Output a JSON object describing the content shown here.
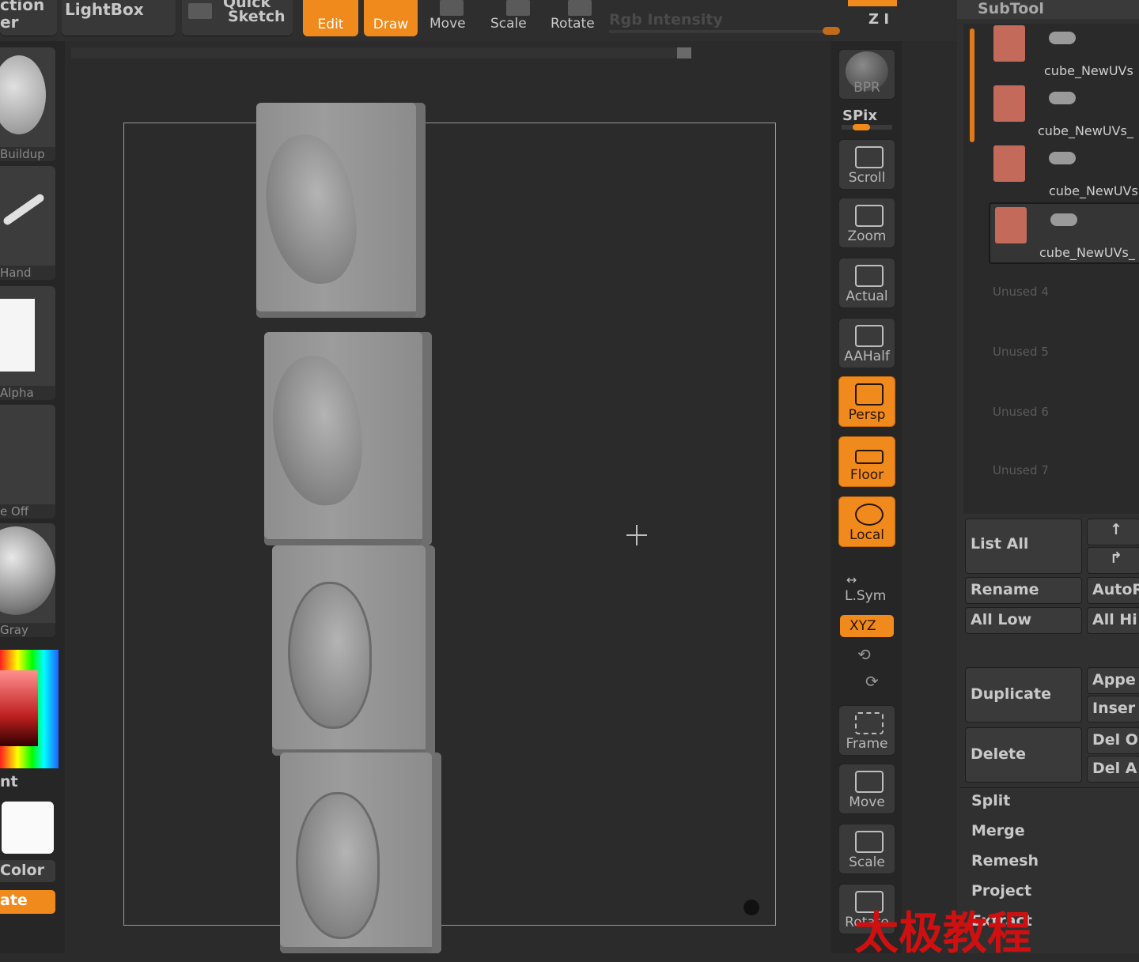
{
  "toolbar": {
    "partial_left_top": "ction",
    "partial_left_bottom": "er",
    "lightbox": "LightBox",
    "quick_sketch_line1": "Quick",
    "quick_sketch_line2": "Sketch",
    "edit": "Edit",
    "draw": "Draw",
    "move": "Move",
    "scale": "Scale",
    "rotate": "Rotate",
    "rgb_intensity": "Rgb Intensity",
    "z_intensity": "Z I"
  },
  "left_shelf": {
    "brush": "Buildup",
    "stroke": "Hand",
    "alpha": "Alpha",
    "texture": "e Off",
    "material": "Gray",
    "gradient_label": "nt",
    "color_label": "Color",
    "switch_label": "ate"
  },
  "right_shelf": {
    "bpr": "BPR",
    "spix": "SPix",
    "scroll": "Scroll",
    "zoom": "Zoom",
    "actual": "Actual",
    "aahalf": "AAHalf",
    "persp": "Persp",
    "floor": "Floor",
    "local": "Local",
    "lsym": "L.Sym",
    "xyz": "XYZ",
    "frame": "Frame",
    "move": "Move",
    "scale": "Scale",
    "rotate": "Rotate"
  },
  "subtool": {
    "title": "SubTool",
    "items": [
      {
        "name": "cube_NewUVs"
      },
      {
        "name": "cube_NewUVs_"
      },
      {
        "name": "cube_NewUVs"
      },
      {
        "name": "cube_NewUVs_"
      }
    ],
    "unused": [
      "Unused 4",
      "Unused 5",
      "Unused 6",
      "Unused 7"
    ],
    "buttons": {
      "list_all": "List All",
      "rename": "Rename",
      "autoreorder": "AutoR",
      "all_low": "All Low",
      "all_high": "All Hi",
      "duplicate": "Duplicate",
      "append": "Appe",
      "insert": "Inser",
      "delete": "Delete",
      "del_other": "Del O",
      "del_all": "Del A"
    },
    "sections": [
      "Split",
      "Merge",
      "Remesh",
      "Project",
      "Extract"
    ]
  },
  "watermark": "太极教程",
  "colors": {
    "accent": "#f08a1c",
    "panel": "#303030",
    "background": "#2b2b2b"
  }
}
